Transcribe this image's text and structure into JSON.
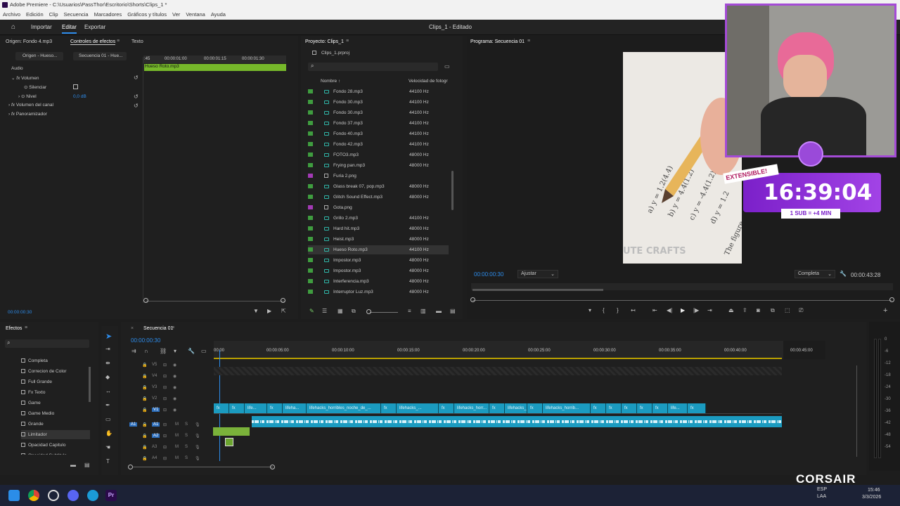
{
  "window": {
    "title": "Adobe Premiere - C:\\Usuarios\\PassThor\\Escritorio\\Shorts\\Clips_1 *"
  },
  "menu": [
    "Archivo",
    "Edición",
    "Clip",
    "Secuencia",
    "Marcadores",
    "Gráficos y títulos",
    "Ver",
    "Ventana",
    "Ayuda"
  ],
  "nav": {
    "import": "Importar",
    "edit": "Editar",
    "export": "Exportar",
    "project_title": "Clips_1 - Editado"
  },
  "effect_controls": {
    "tab_source": "Origen: Fondo 4.mp3",
    "tab_fx": "Controles de efectos",
    "tab_text": "Texto",
    "master_clip": "Origen - Hueso...",
    "seq_clip": "Secuencia 01 - Hue...",
    "ruler": [
      ":45",
      "00:00:01:00",
      "00:00:01:15",
      "00:00:01:30"
    ],
    "clip_name": "Hueso Roto.mp3",
    "audio": "Audio",
    "volume": "Volumen",
    "mute": "Silenciar",
    "level": "Nivel",
    "level_value": "0,0 dB",
    "channel_volume": "Volumen del canal",
    "panner": "Panoramizador",
    "timecode": "00:00:00:30"
  },
  "project": {
    "title": "Proyecto: Clips_1",
    "file": "Clips_1.prproj",
    "col_name": "Nombre",
    "col_rate": "Velocidad de fotogr",
    "items": [
      {
        "name": "Fondo 28.mp3",
        "rate": "44100 Hz",
        "kind": "audio"
      },
      {
        "name": "Fondo 30.mp3",
        "rate": "44100 Hz",
        "kind": "audio"
      },
      {
        "name": "Fondo 30.mp3",
        "rate": "44100 Hz",
        "kind": "audio"
      },
      {
        "name": "Fondo 37.mp3",
        "rate": "44100 Hz",
        "kind": "audio"
      },
      {
        "name": "Fondo 40.mp3",
        "rate": "44100 Hz",
        "kind": "audio"
      },
      {
        "name": "Fondo 42.mp3",
        "rate": "44100 Hz",
        "kind": "audio"
      },
      {
        "name": "FOTO3.mp3",
        "rate": "48000 Hz",
        "kind": "audio"
      },
      {
        "name": "Frying pan.mp3",
        "rate": "48000 Hz",
        "kind": "audio"
      },
      {
        "name": "Furia 2.png",
        "rate": "",
        "kind": "image"
      },
      {
        "name": "Glass break 07, pop.mp3",
        "rate": "48000 Hz",
        "kind": "audio"
      },
      {
        "name": "Glitch Sound Effect.mp3",
        "rate": "48000 Hz",
        "kind": "audio"
      },
      {
        "name": "Gota.png",
        "rate": "",
        "kind": "image"
      },
      {
        "name": "Grillo 2.mp3",
        "rate": "44100 Hz",
        "kind": "audio"
      },
      {
        "name": "Hard hit.mp3",
        "rate": "48000 Hz",
        "kind": "audio"
      },
      {
        "name": "Heist.mp3",
        "rate": "48000 Hz",
        "kind": "audio"
      },
      {
        "name": "Hueso Roto.mp3",
        "rate": "44100 Hz",
        "kind": "audio"
      },
      {
        "name": "Impostor.mp3",
        "rate": "48000 Hz",
        "kind": "audio"
      },
      {
        "name": "Impostor.mp3",
        "rate": "48000 Hz",
        "kind": "audio"
      },
      {
        "name": "Interferencia.mp3",
        "rate": "48000 Hz",
        "kind": "audio"
      },
      {
        "name": "Interruptor Luz.mp3",
        "rate": "48000 Hz",
        "kind": "audio"
      }
    ]
  },
  "program": {
    "title": "Programa: Secuencia 01",
    "timecode": "00:00:00:30",
    "fit": "Ajustar",
    "quality": "Completa",
    "duration": "00:00:43:28",
    "watermark": "UTE CRAFTS"
  },
  "overlay": {
    "badge": "EXTENSIBLE!",
    "clock": "16:39:04",
    "sub": "1 SUB = +4 MIN",
    "brand": "CORSAIR"
  },
  "effects": {
    "title": "Efectos",
    "items": [
      "Completa",
      "Correcion de Color",
      "Full Grande",
      "Fx Texto",
      "Game",
      "Game Medio",
      "Grande",
      "Limitador",
      "Opacidad Capitulo",
      "Opacidad Subtitulo"
    ]
  },
  "timeline": {
    "title": "Secuencia 01",
    "timecode": "00:00:00:30",
    "ruler": [
      "00:00",
      "00:00:05:00",
      "00:00:10:00",
      "00:00:15:00",
      "00:00:20:00",
      "00:00:25:00",
      "00:00:30:00",
      "00:00:35:00",
      "00:00:40:00",
      "00:00:45:00"
    ],
    "tracks_video": [
      "V5",
      "V4",
      "V3",
      "V2",
      "V1"
    ],
    "tracks_audio": [
      "A1",
      "A2",
      "A3",
      "A4"
    ],
    "clips": [
      "fx",
      "fx",
      "life...",
      "fx",
      "lifeha...",
      "lifehacks_horribles_noche_de_...",
      "fx",
      "lifehacks_...",
      "fx",
      "lifehacks_horr...",
      "fx",
      "lifehacks_...",
      "fx",
      "lifehacks_horrib...",
      "fx",
      "fx",
      "fx",
      "fx",
      "fx",
      "life...",
      "fx"
    ]
  },
  "meter": [
    "0",
    "-6",
    "-12",
    "-18",
    "-24",
    "-30",
    "-36",
    "-42",
    "-48",
    "-54"
  ],
  "taskbar": {
    "lang": "ESP",
    "region": "LAA",
    "time": "15:46",
    "date": "3/3/2026"
  }
}
